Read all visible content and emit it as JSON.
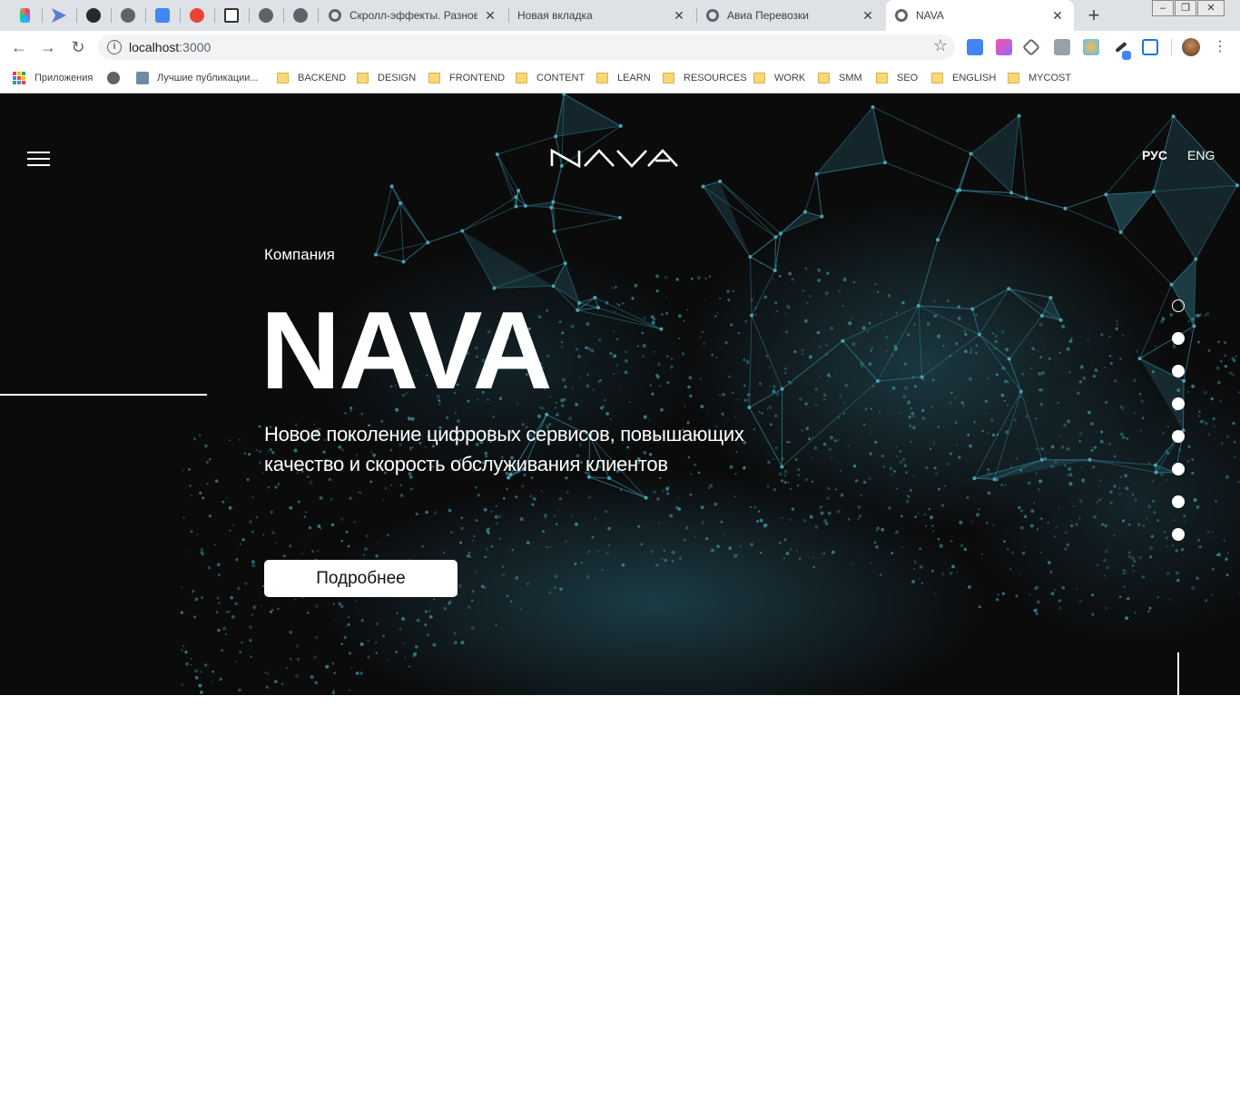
{
  "browser": {
    "tabs": [
      {
        "title": "Скролл-эффекты. Разновидн",
        "active": false
      },
      {
        "title": "Новая вкладка",
        "active": false
      },
      {
        "title": "Авиа Перевозки",
        "active": false
      },
      {
        "title": "NAVA",
        "active": true
      }
    ],
    "pinned_icons": [
      "figma-icon",
      "send-icon",
      "github-icon",
      "globe-icon",
      "translate-icon",
      "gmail-icon",
      "download-icon",
      "globe-icon",
      "globe-icon"
    ],
    "new_tab_label": "+",
    "url_host": "localhost",
    "url_port": ":3000",
    "bookmarks": [
      {
        "label": "Приложения",
        "icon": "apps-grid-icon"
      },
      {
        "label": "",
        "icon": "globe-icon"
      },
      {
        "label": "Лучшие публикации...",
        "icon": "habr-icon"
      },
      {
        "label": "BACKEND",
        "icon": "folder-icon"
      },
      {
        "label": "DESIGN",
        "icon": "folder-icon"
      },
      {
        "label": "FRONTEND",
        "icon": "folder-icon"
      },
      {
        "label": "CONTENT",
        "icon": "folder-icon"
      },
      {
        "label": "LEARN",
        "icon": "folder-icon"
      },
      {
        "label": "RESOURCES",
        "icon": "folder-icon"
      },
      {
        "label": "WORK",
        "icon": "folder-icon"
      },
      {
        "label": "SMM",
        "icon": "folder-icon"
      },
      {
        "label": "SEO",
        "icon": "folder-icon"
      },
      {
        "label": "ENGLISH",
        "icon": "folder-icon"
      },
      {
        "label": "MYCOST",
        "icon": "folder-icon"
      }
    ]
  },
  "site": {
    "logo_text": "NAVA",
    "lang_ru": "РУС",
    "lang_en": "ENG",
    "kicker": "Компания",
    "title": "NAVA",
    "subtitle": "Новое поколение цифровых сервисов, повышающих качество и скорость обслуживания клиентов",
    "cta": "Подробнее",
    "slides_count": 8,
    "active_slide": 1,
    "colors": {
      "background": "#0b0b0c",
      "accent": "#3a8c9c",
      "text": "#ffffff"
    }
  }
}
